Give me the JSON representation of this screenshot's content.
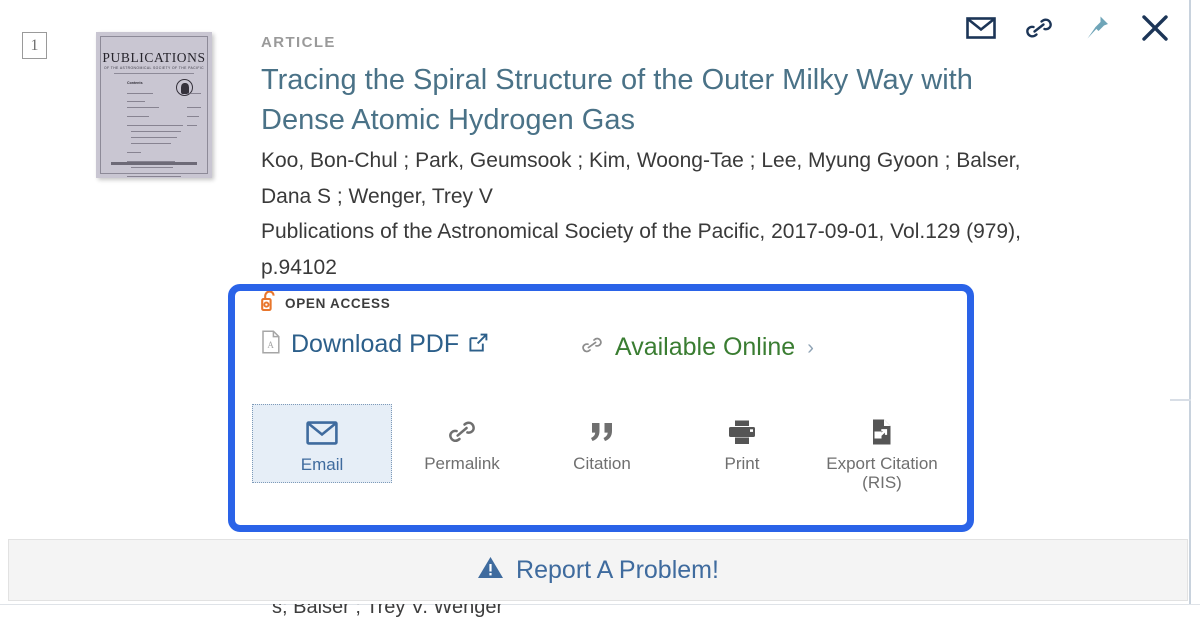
{
  "record": {
    "index": "1",
    "type_label": "ARTICLE",
    "title": "Tracing the Spiral Structure of the Outer Milky Way with Dense Atomic Hydrogen Gas",
    "authors": "Koo, Bon-Chul ; Park, Geumsook ; Kim, Woong-Tae ; Lee, Myung Gyoon ; Balser, Dana S ; Wenger, Trey V",
    "source": "Publications of the Astronomical Society of the Pacific, 2017-09-01, Vol.129 (979), p.94102"
  },
  "thumbnail": {
    "cover_title": "PUBLICATIONS",
    "cover_subtitle": "OF THE ASTRONOMICAL SOCIETY OF THE PACIFIC",
    "contents_label": "Contents"
  },
  "topbar": {
    "icons": [
      {
        "name": "email-icon",
        "label": "Email"
      },
      {
        "name": "permalink-icon",
        "label": "Permalink"
      },
      {
        "name": "pin-icon",
        "label": "Pin"
      },
      {
        "name": "close-icon",
        "label": "Close"
      }
    ]
  },
  "access": {
    "badge_icon": "open-lock-icon",
    "badge_label": "OPEN ACCESS",
    "download_label": "Download PDF",
    "download_icon": "pdf-file-icon",
    "download_external_icon": "external-link-icon",
    "available_label": "Available Online",
    "available_icon": "link-chain-icon",
    "available_chevron": "›"
  },
  "actions": [
    {
      "id": "email",
      "label": "Email",
      "icon": "envelope-icon",
      "active": true
    },
    {
      "id": "permalink",
      "label": "Permalink",
      "icon": "link-chain-icon",
      "active": false
    },
    {
      "id": "citation",
      "label": "Citation",
      "icon": "quote-icon",
      "active": false
    },
    {
      "id": "print",
      "label": "Print",
      "icon": "printer-icon",
      "active": false
    },
    {
      "id": "export",
      "label": "Export Citation (RIS)",
      "icon": "export-file-icon",
      "active": false
    }
  ],
  "report": {
    "label": "Report A Problem!",
    "icon": "warning-triangle-icon"
  },
  "underlay": {
    "text": "s; Balser ; Trey V. Wenger"
  },
  "colors": {
    "highlight_border": "#2a63e8",
    "title": "#4a7287",
    "download_link": "#2c5f8a",
    "available_link": "#3a7d32",
    "open_access_badge": "#e8762c",
    "active_action": "#3f6b9e",
    "pin_icon": "#6fa5b8",
    "topbar_icon": "#1c3557"
  }
}
